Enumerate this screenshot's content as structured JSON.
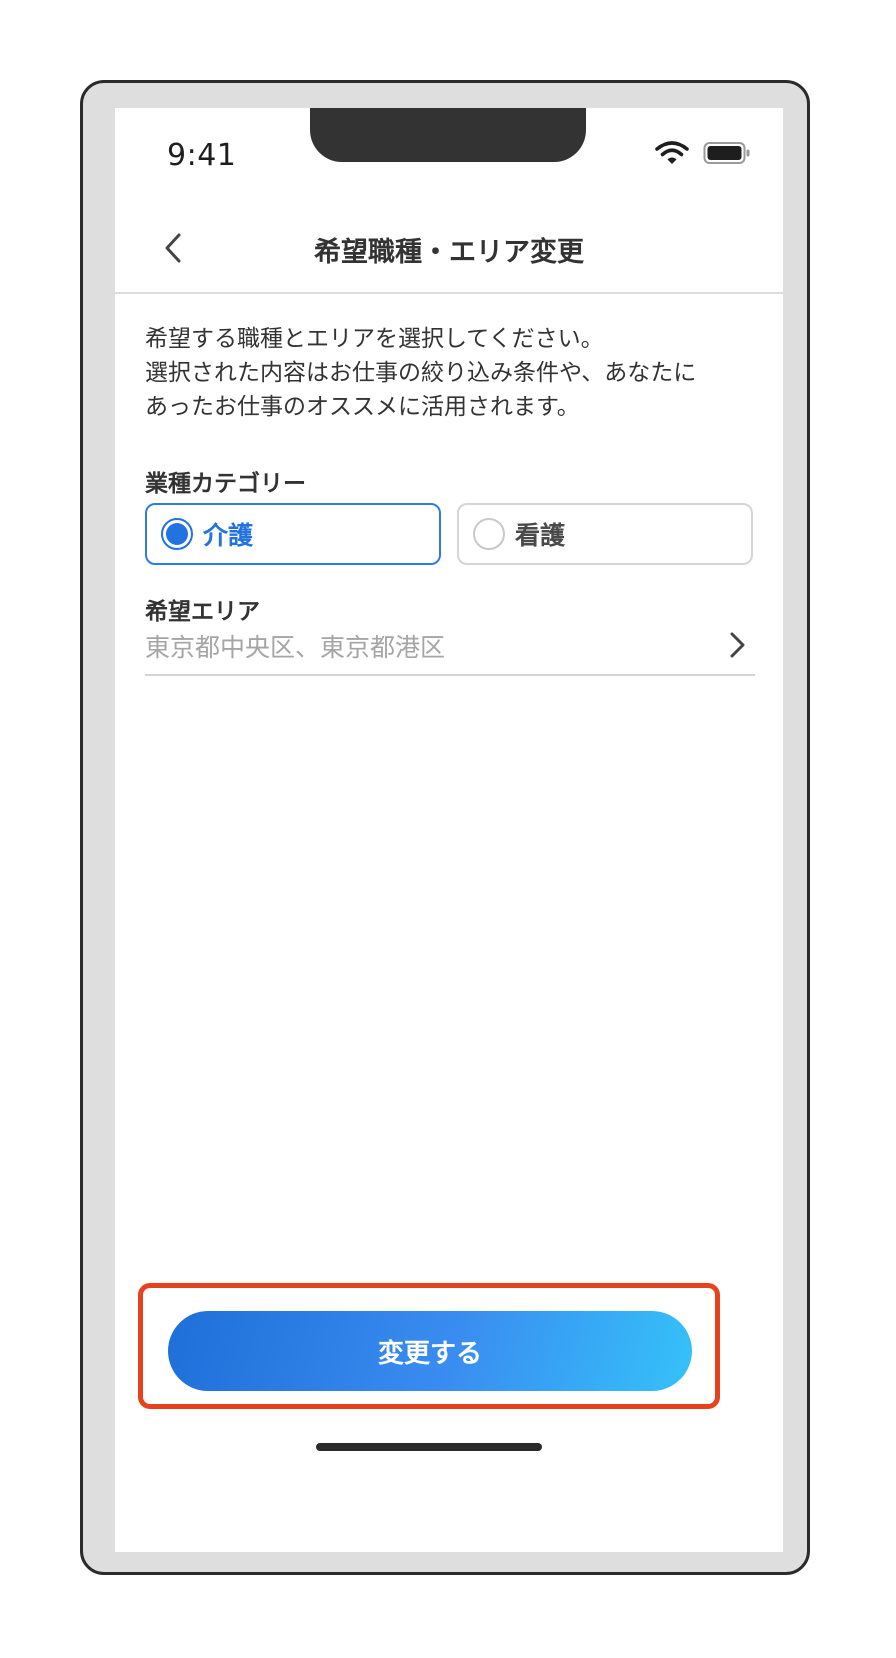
{
  "status_bar": {
    "time": "9:41"
  },
  "nav": {
    "title": "希望職種・エリア変更"
  },
  "description": {
    "lines": [
      "希望する職種とエリアを選択してください。",
      "選択された内容はお仕事の絞り込み条件や、あなたに",
      "あったお仕事のオススメに活用されます。"
    ]
  },
  "category": {
    "label": "業種カテゴリー",
    "options": [
      {
        "label": "介護",
        "selected": true
      },
      {
        "label": "看護",
        "selected": false
      }
    ]
  },
  "area": {
    "label": "希望エリア",
    "value": "東京都中央区、東京都港区"
  },
  "submit": {
    "label": "変更する"
  },
  "colors": {
    "accent": "#2272e0",
    "highlight_border": "#e8411e",
    "button_gradient_start": "#1e6fd8",
    "button_gradient_end": "#35c2f9"
  }
}
